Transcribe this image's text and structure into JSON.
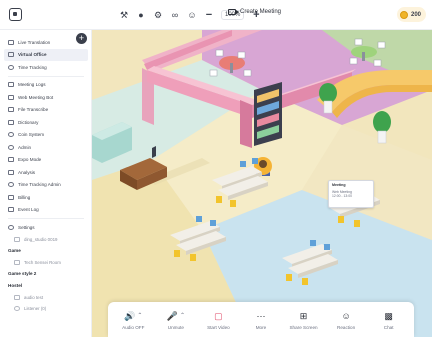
{
  "toolbar": {
    "zoom_value": "100%",
    "zoom_out": "−",
    "zoom_in": "+",
    "create_meeting": "Create Meeting",
    "coins": "200",
    "tools": [
      "hammer-icon",
      "mic-icon",
      "settings-icon",
      "link-icon",
      "emoji-icon"
    ]
  },
  "sidebar": {
    "add": "+",
    "items": [
      {
        "label": "Live Translation",
        "icon": "translate-icon"
      },
      {
        "label": "Virtual Office",
        "icon": "office-icon",
        "active": true
      },
      {
        "label": "Time Tracking",
        "icon": "clock-icon"
      },
      {
        "label": "Meeting Logs",
        "icon": "logs-icon"
      },
      {
        "label": "Web Meeting Bot",
        "icon": "bot-icon"
      },
      {
        "label": "File Transcribe",
        "icon": "file-icon"
      },
      {
        "label": "Dictionary",
        "icon": "book-icon"
      },
      {
        "label": "Coin System",
        "icon": "coin-icon"
      },
      {
        "label": "Admin",
        "icon": "admin-icon"
      },
      {
        "label": "Expo Mode",
        "icon": "expo-icon"
      },
      {
        "label": "Analysis",
        "icon": "chart-icon"
      },
      {
        "label": "Time Tracking Admin",
        "icon": "clock-admin-icon"
      },
      {
        "label": "Billing",
        "icon": "billing-icon"
      },
      {
        "label": "Event Log",
        "icon": "event-icon"
      },
      {
        "label": "Settings",
        "icon": "gear-icon"
      }
    ],
    "settings_sub": "ding_studio 0019",
    "groups": [
      {
        "title": "Game",
        "sub": "Tech Sensei Room"
      },
      {
        "title": "Game style 2",
        "sub": ""
      },
      {
        "title": "Hostel",
        "sub": "audio test"
      }
    ],
    "listener": "Listener (0)"
  },
  "map": {
    "meeting_card": {
      "title": "Meeting",
      "line1": "Web Meeting",
      "line2": "12:00 - 13:00"
    }
  },
  "dock": {
    "buttons": [
      {
        "label": "Audio OFF",
        "icon": "speaker-icon",
        "caret": true
      },
      {
        "label": "Unmute",
        "icon": "mic-off-icon",
        "caret": true,
        "off": true
      },
      {
        "label": "Start Video",
        "icon": "video-off-icon",
        "off": true
      },
      {
        "label": "More",
        "icon": "more-icon"
      },
      {
        "label": "Share Screen",
        "icon": "share-screen-icon"
      },
      {
        "label": "Reaction",
        "icon": "reaction-icon"
      },
      {
        "label": "Chat",
        "icon": "chat-icon"
      }
    ]
  },
  "colors": {
    "floor": "#f4ebc9",
    "pink_room": "#d8a6d4",
    "blue_zone": "#c7e2f0",
    "accent_off": "#e04d6a",
    "coin": "#f0b429"
  }
}
